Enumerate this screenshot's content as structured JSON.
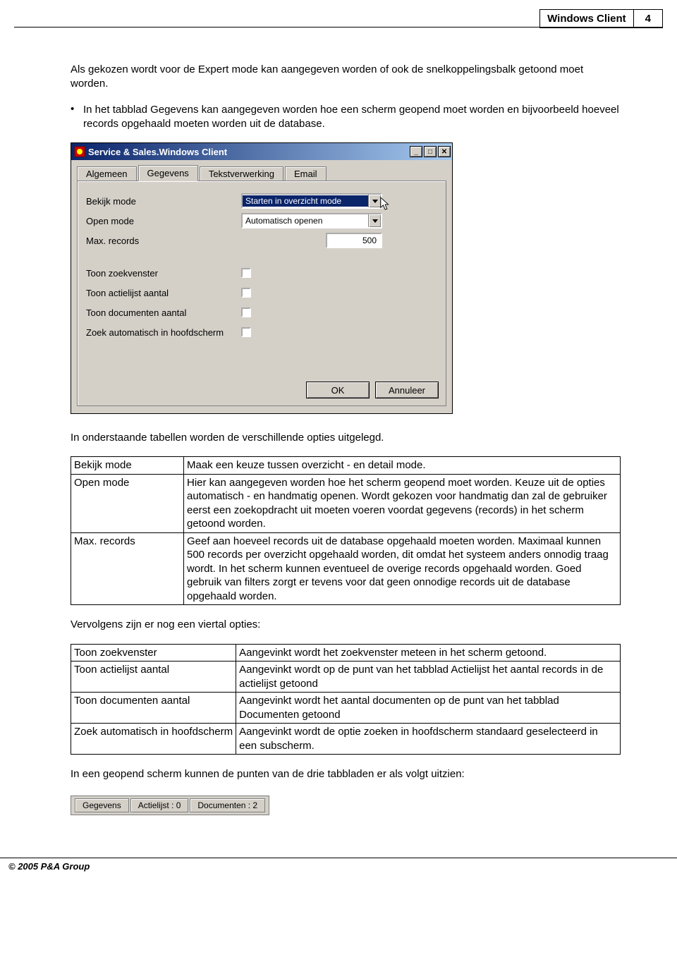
{
  "header": {
    "title": "Windows Client",
    "page": "4"
  },
  "intro_para": "Als gekozen wordt voor de Expert mode kan aangegeven worden of ook de snelkoppelingsbalk getoond moet worden.",
  "bullet_para": "In het tabblad Gegevens kan aangegeven worden hoe een scherm geopend moet worden en bijvoorbeeld hoeveel records opgehaald moeten worden uit de database.",
  "dialog": {
    "title": "Service & Sales.Windows Client",
    "tabs": [
      "Algemeen",
      "Gegevens",
      "Tekstverwerking",
      "Email"
    ],
    "active_tab": "Gegevens",
    "rows": {
      "bekijk_label": "Bekijk mode",
      "bekijk_value": "Starten in overzicht mode",
      "open_label": "Open mode",
      "open_value": "Automatisch openen",
      "max_label": "Max. records",
      "max_value": "500",
      "chk1": "Toon zoekvenster",
      "chk2": "Toon actielijst aantal",
      "chk3": "Toon documenten aantal",
      "chk4": "Zoek automatisch in hoofdscherm"
    },
    "buttons": {
      "ok": "OK",
      "cancel": "Annuleer"
    }
  },
  "after_dialog": "In onderstaande tabellen worden de verschillende opties uitgelegd.",
  "table1": [
    {
      "k": "Bekijk mode",
      "v": "Maak een keuze tussen overzicht - en detail mode."
    },
    {
      "k": "Open mode",
      "v": "Hier kan aangegeven worden hoe het scherm geopend moet worden. Keuze uit de opties automatisch - en handmatig openen. Wordt gekozen voor handmatig dan zal de gebruiker eerst een zoekopdracht uit moeten voeren voordat gegevens (records) in het scherm getoond worden."
    },
    {
      "k": "Max. records",
      "v": "Geef aan hoeveel records uit de database opgehaald moeten worden. Maximaal kunnen 500 records per overzicht opgehaald worden, dit omdat het systeem anders onnodig traag wordt. In het scherm kunnen eventueel de overige records opgehaald worden. Goed gebruik van filters zorgt er tevens voor dat geen onnodige records uit de database opgehaald worden."
    }
  ],
  "mid_para": "Vervolgens zijn er nog een viertal opties:",
  "table2": [
    {
      "k": "Toon zoekvenster",
      "v": "Aangevinkt wordt het zoekvenster meteen in het scherm getoond."
    },
    {
      "k": "Toon actielijst aantal",
      "v": "Aangevinkt wordt op de punt van het tabblad Actielijst het aantal records in de actielijst getoond"
    },
    {
      "k": "Toon documenten aantal",
      "v": "Aangevinkt wordt het aantal documenten op de punt van het tabblad Documenten getoond"
    },
    {
      "k": "Zoek automatisch in hoofdscherm",
      "v": "Aangevinkt wordt de optie zoeken in hoofdscherm standaard geselecteerd in een subscherm."
    }
  ],
  "closing_para": "In een geopend scherm kunnen de punten van de drie tabbladen er als volgt uitzien:",
  "minitabs": [
    "Gegevens",
    "Actielijst : 0",
    "Documenten : 2"
  ],
  "footer": "© 2005 P&A Group"
}
